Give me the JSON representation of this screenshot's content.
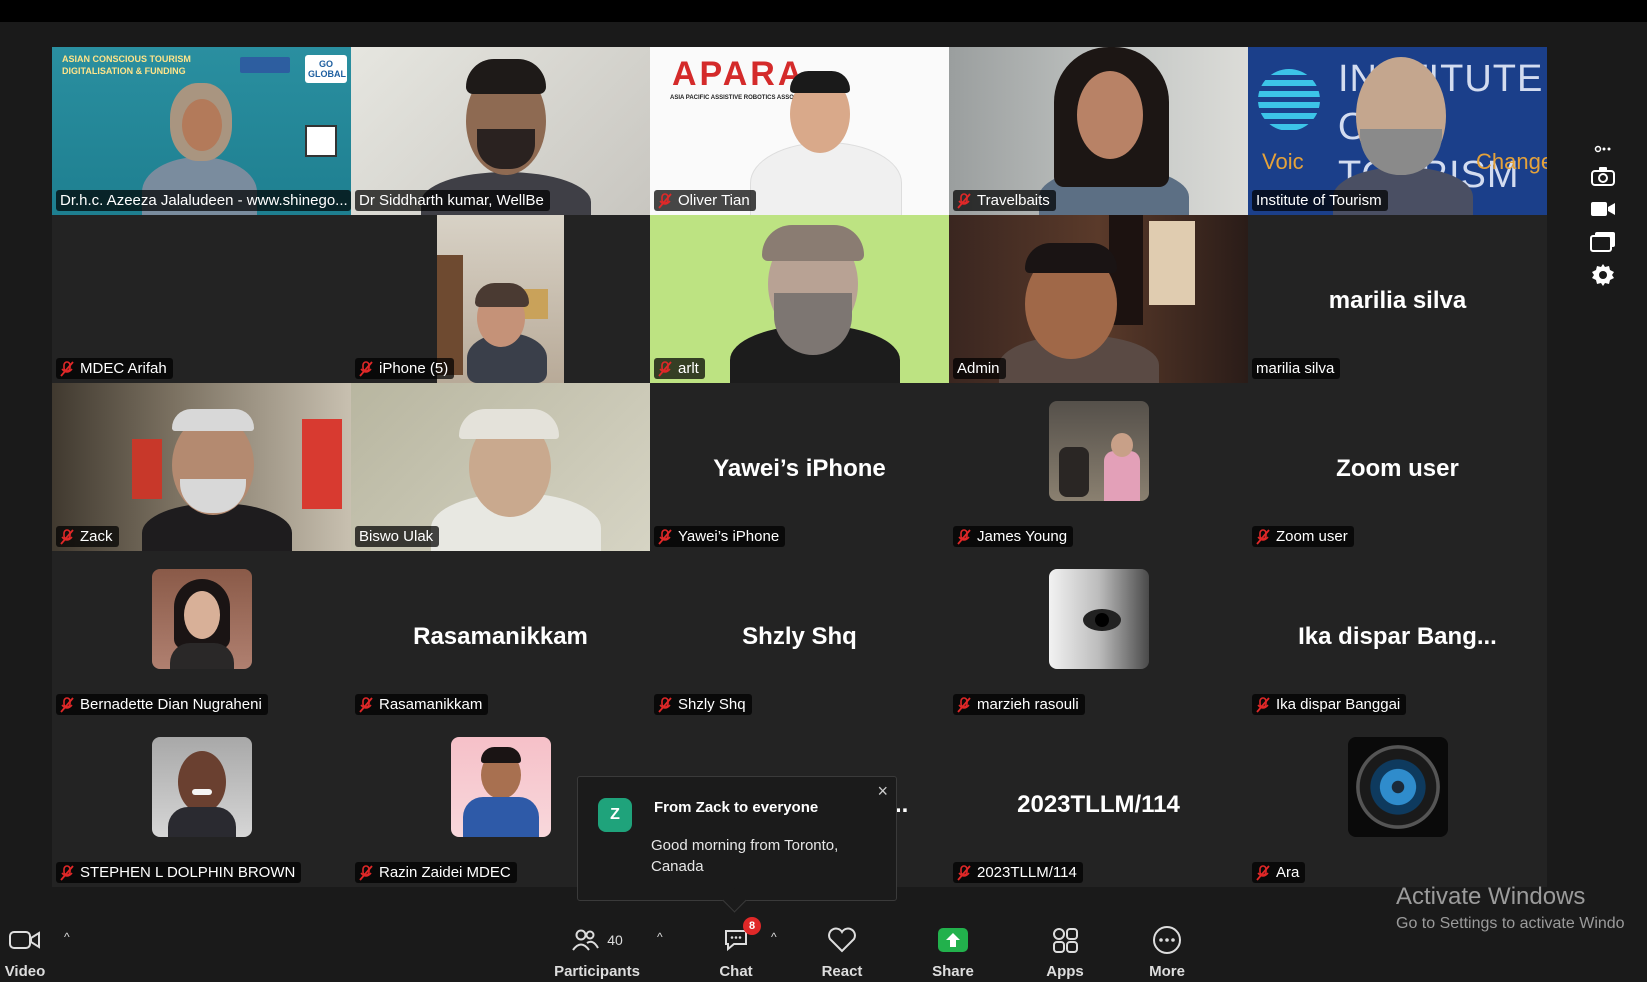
{
  "gallery": {
    "tiles": [
      {
        "name": "Dr.h.c. Azeeza Jalaludeen - www.shinego...",
        "muted": false,
        "video": true,
        "banner_title": "ASIAN CONSCIOUS TOURISM DIGITALISATION & FUNDING",
        "logo": "GO GLOBAL"
      },
      {
        "name": "Dr Siddharth kumar, WellBe",
        "muted": false,
        "video": true
      },
      {
        "name": "Oliver Tian",
        "muted": true,
        "video": true,
        "banner_title": "APARA",
        "banner_sub": "ASIA PACIFIC ASSISTIVE ROBOTICS ASSOCI"
      },
      {
        "name": "Travelbaits",
        "muted": true,
        "video": true
      },
      {
        "name": "Institute of Tourism",
        "muted": false,
        "video": true,
        "active": true,
        "banner_title": "INSTITUTE OF TOURISM",
        "banner_sub_left": "Voic",
        "banner_sub_right": "Change"
      },
      {
        "name": "MDEC Arifah",
        "muted": true,
        "video": false
      },
      {
        "name": "iPhone (5)",
        "muted": true,
        "video": true
      },
      {
        "name": "arlt",
        "muted": true,
        "video": true
      },
      {
        "name": "Admin",
        "muted": false,
        "video": true
      },
      {
        "name": "marilia silva",
        "muted": false,
        "video": false,
        "display": "marilia silva"
      },
      {
        "name": "Zack",
        "muted": true,
        "video": true
      },
      {
        "name": "Biswo Ulak",
        "muted": false,
        "video": true
      },
      {
        "name": "Yawei’s iPhone",
        "muted": true,
        "video": false,
        "display": "Yawei’s iPhone"
      },
      {
        "name": "James Young",
        "muted": true,
        "video": false,
        "avatar": true
      },
      {
        "name": "Zoom user",
        "muted": true,
        "video": false,
        "display": "Zoom user"
      },
      {
        "name": "Bernadette Dian Nugraheni",
        "muted": true,
        "video": false,
        "avatar": true
      },
      {
        "name": "Rasamanikkam",
        "muted": true,
        "video": false,
        "display": "Rasamanikkam"
      },
      {
        "name": "Shzly Shq",
        "muted": true,
        "video": false,
        "display": "Shzly Shq"
      },
      {
        "name": "marzieh rasouli",
        "muted": true,
        "video": false,
        "avatar": true
      },
      {
        "name": "Ika dispar Banggai",
        "muted": true,
        "video": false,
        "display": "Ika dispar Bang..."
      },
      {
        "name": "STEPHEN L DOLPHIN BROWN",
        "muted": true,
        "video": false,
        "avatar": true
      },
      {
        "name": "Razin Zaidei MDEC",
        "muted": true,
        "video": false,
        "avatar": true
      },
      {
        "name": "",
        "muted": false,
        "video": false,
        "display": ".."
      },
      {
        "name": "2023TLLM/114",
        "muted": true,
        "video": false,
        "display": "2023TLLM/114"
      },
      {
        "name": "Ara",
        "muted": true,
        "video": false,
        "avatar": true
      }
    ]
  },
  "chat_popup": {
    "avatar_letter": "Z",
    "from": "From Zack to everyone",
    "message": "Good morning from Toronto, Canada",
    "close_icon": "close-icon"
  },
  "toolbar": {
    "video_label": "Video",
    "participants_label": "Participants",
    "participants_count": "40",
    "chat_label": "Chat",
    "chat_badge": "8",
    "react_label": "React",
    "share_label": "Share",
    "apps_label": "Apps",
    "more_label": "More"
  },
  "watermark": {
    "title": "Activate Windows",
    "subtitle": "Go to Settings to activate Windo"
  },
  "colors": {
    "active_speaker": "#22d39a",
    "share_green": "#22b14c",
    "mute_red": "#e02828",
    "background": "#1a1a1a"
  }
}
